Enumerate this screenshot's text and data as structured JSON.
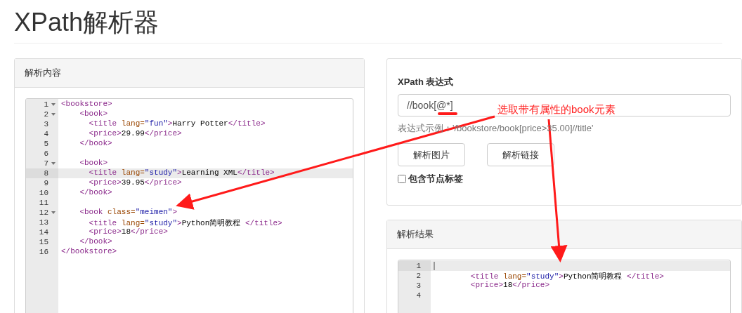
{
  "page_title": "XPath解析器",
  "source_panel": {
    "title": "解析内容",
    "lines": [
      {
        "number": "1",
        "foldable": true,
        "active": false,
        "tokens": [
          {
            "kind": "tag",
            "text": "<bookstore>"
          }
        ]
      },
      {
        "number": "2",
        "foldable": true,
        "active": false,
        "tokens": [
          {
            "kind": "tag",
            "text": "    <book>"
          }
        ]
      },
      {
        "number": "3",
        "foldable": false,
        "active": false,
        "tokens": [
          {
            "kind": "tag",
            "text": "      <title "
          },
          {
            "kind": "attr",
            "text": "lang="
          },
          {
            "kind": "value",
            "text": "\"fun\""
          },
          {
            "kind": "tag",
            "text": ">"
          },
          {
            "kind": "text",
            "text": "Harry Potter"
          },
          {
            "kind": "tag",
            "text": "</title>"
          }
        ]
      },
      {
        "number": "4",
        "foldable": false,
        "active": false,
        "tokens": [
          {
            "kind": "tag",
            "text": "      <price>"
          },
          {
            "kind": "text",
            "text": "29.99"
          },
          {
            "kind": "tag",
            "text": "</price>"
          }
        ]
      },
      {
        "number": "5",
        "foldable": false,
        "active": false,
        "tokens": [
          {
            "kind": "tag",
            "text": "    </book>"
          }
        ]
      },
      {
        "number": "6",
        "foldable": false,
        "active": false
      },
      {
        "number": "7",
        "foldable": true,
        "active": false,
        "tokens": [
          {
            "kind": "tag",
            "text": "    <book>"
          }
        ]
      },
      {
        "number": "8",
        "foldable": false,
        "active": true,
        "tokens": [
          {
            "kind": "tag",
            "text": "      <title "
          },
          {
            "kind": "attr",
            "text": "lang="
          },
          {
            "kind": "value",
            "text": "\"study\""
          },
          {
            "kind": "tag",
            "text": ">"
          },
          {
            "kind": "text",
            "text": "Learning XML"
          },
          {
            "kind": "tag",
            "text": "</title>"
          }
        ]
      },
      {
        "number": "9",
        "foldable": false,
        "active": false,
        "tokens": [
          {
            "kind": "tag",
            "text": "      <price>"
          },
          {
            "kind": "text",
            "text": "39.95"
          },
          {
            "kind": "tag",
            "text": "</price>"
          }
        ]
      },
      {
        "number": "10",
        "foldable": false,
        "active": false,
        "tokens": [
          {
            "kind": "tag",
            "text": "    </book>"
          }
        ]
      },
      {
        "number": "11",
        "foldable": false,
        "active": false
      },
      {
        "number": "12",
        "foldable": true,
        "active": false,
        "tokens": [
          {
            "kind": "tag",
            "text": "    <book "
          },
          {
            "kind": "attr",
            "text": "class="
          },
          {
            "kind": "value",
            "text": "\"meimen\""
          },
          {
            "kind": "tag",
            "text": ">"
          }
        ]
      },
      {
        "number": "13",
        "foldable": false,
        "active": false,
        "tokens": [
          {
            "kind": "tag",
            "text": "      <title "
          },
          {
            "kind": "attr",
            "text": "lang="
          },
          {
            "kind": "value",
            "text": "\"study\""
          },
          {
            "kind": "tag",
            "text": ">"
          },
          {
            "kind": "text",
            "text": "Python简明教程"
          },
          {
            "kind": "tag",
            "text": " </title>"
          }
        ]
      },
      {
        "number": "14",
        "foldable": false,
        "active": false,
        "tokens": [
          {
            "kind": "tag",
            "text": "      <price>"
          },
          {
            "kind": "text",
            "text": "18"
          },
          {
            "kind": "tag",
            "text": "</price>"
          }
        ]
      },
      {
        "number": "15",
        "foldable": false,
        "active": false,
        "tokens": [
          {
            "kind": "tag",
            "text": "    </book>"
          }
        ]
      },
      {
        "number": "16",
        "foldable": false,
        "active": false,
        "tokens": [
          {
            "kind": "tag",
            "text": "</bookstore>"
          }
        ]
      }
    ]
  },
  "query_panel": {
    "label": "XPath 表达式",
    "expression": "//book[@*]",
    "hint": "表达式示例：'/bookstore/book[price>35.00]//title'",
    "buttons": [
      "解析图片",
      "解析链接"
    ],
    "checkbox": {
      "label": "包含节点标签",
      "checked": false
    }
  },
  "result_panel": {
    "title": "解析结果",
    "lines": [
      {
        "number": "1",
        "foldable": false,
        "active": true
      },
      {
        "number": "2",
        "foldable": false,
        "active": false,
        "tokens": [
          {
            "kind": "tag",
            "text": "        <title "
          },
          {
            "kind": "attr",
            "text": "lang="
          },
          {
            "kind": "value",
            "text": "\"study\""
          },
          {
            "kind": "tag",
            "text": ">"
          },
          {
            "kind": "text",
            "text": "Python简明教程"
          },
          {
            "kind": "tag",
            "text": " </title>"
          }
        ]
      },
      {
        "number": "3",
        "foldable": false,
        "active": false,
        "tokens": [
          {
            "kind": "tag",
            "text": "        <price>"
          },
          {
            "kind": "text",
            "text": "18"
          },
          {
            "kind": "tag",
            "text": "</price>"
          }
        ]
      },
      {
        "number": "4",
        "foldable": false,
        "active": false
      }
    ]
  },
  "annotation": {
    "text": "选取带有属性的book元素"
  }
}
